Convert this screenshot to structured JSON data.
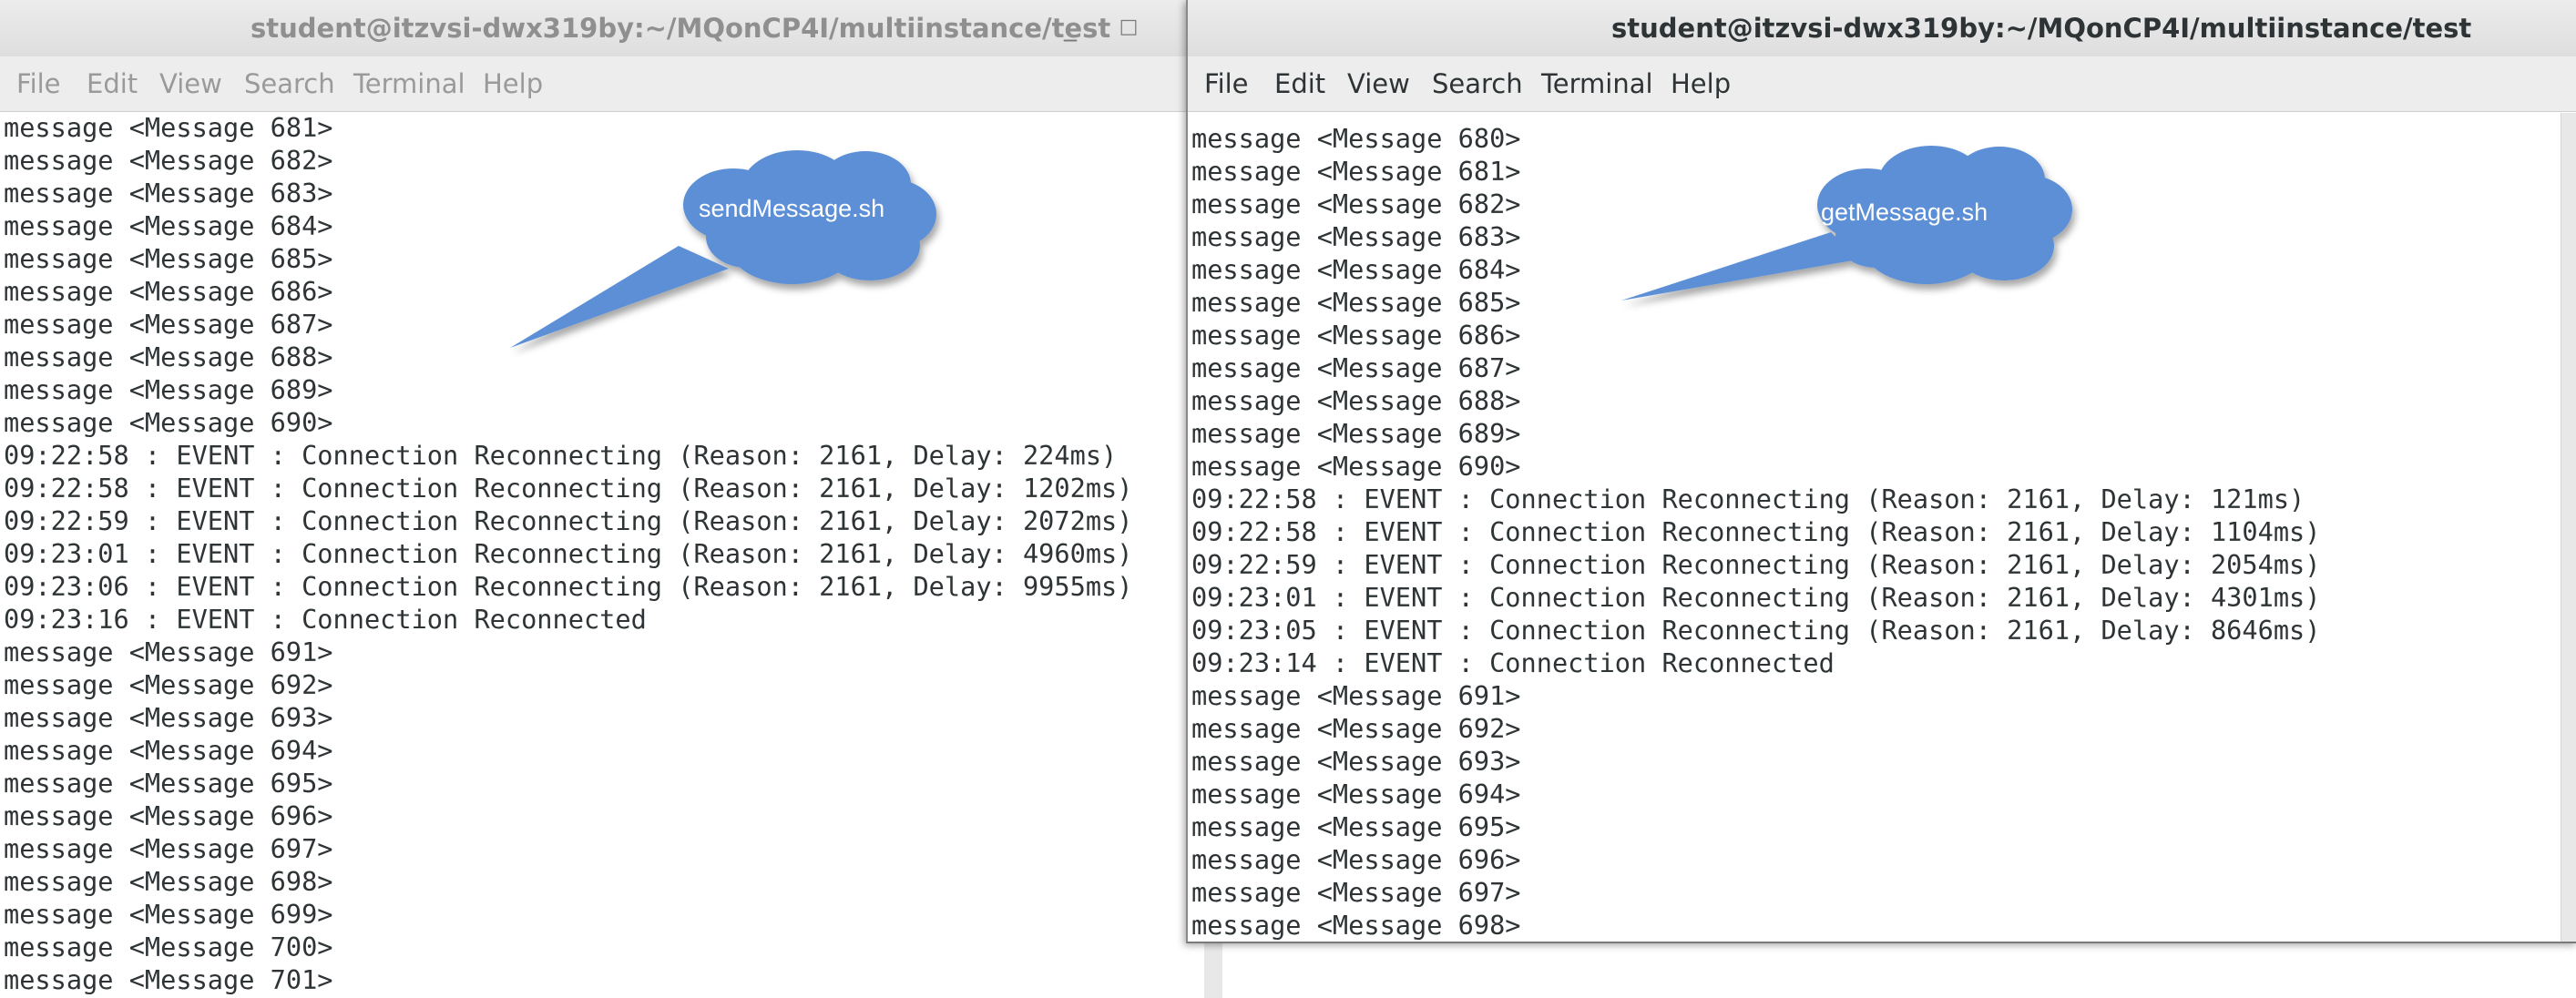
{
  "left_window": {
    "title": "student@itzvsi-dwx319by:~/MQonCP4I/multiinstance/test",
    "menu": [
      "File",
      "Edit",
      "View",
      "Search",
      "Terminal",
      "Help"
    ],
    "lines": [
      "message <Message 681>",
      "message <Message 682>",
      "message <Message 683>",
      "message <Message 684>",
      "message <Message 685>",
      "message <Message 686>",
      "message <Message 687>",
      "message <Message 688>",
      "message <Message 689>",
      "message <Message 690>",
      "09:22:58 : EVENT : Connection Reconnecting (Reason: 2161, Delay: 224ms)",
      "09:22:58 : EVENT : Connection Reconnecting (Reason: 2161, Delay: 1202ms)",
      "09:22:59 : EVENT : Connection Reconnecting (Reason: 2161, Delay: 2072ms)",
      "09:23:01 : EVENT : Connection Reconnecting (Reason: 2161, Delay: 4960ms)",
      "09:23:06 : EVENT : Connection Reconnecting (Reason: 2161, Delay: 9955ms)",
      "09:23:16 : EVENT : Connection Reconnected",
      "message <Message 691>",
      "message <Message 692>",
      "message <Message 693>",
      "message <Message 694>",
      "message <Message 695>",
      "message <Message 696>",
      "message <Message 697>",
      "message <Message 698>",
      "message <Message 699>",
      "message <Message 700>",
      "message <Message 701>"
    ]
  },
  "right_window": {
    "title": "student@itzvsi-dwx319by:~/MQonCP4I/multiinstance/test",
    "menu": [
      "File",
      "Edit",
      "View",
      "Search",
      "Terminal",
      "Help"
    ],
    "lines": [
      "message <Message 680>",
      "message <Message 681>",
      "message <Message 682>",
      "message <Message 683>",
      "message <Message 684>",
      "message <Message 685>",
      "message <Message 686>",
      "message <Message 687>",
      "message <Message 688>",
      "message <Message 689>",
      "message <Message 690>",
      "09:22:58 : EVENT : Connection Reconnecting (Reason: 2161, Delay: 121ms)",
      "09:22:58 : EVENT : Connection Reconnecting (Reason: 2161, Delay: 1104ms)",
      "09:22:59 : EVENT : Connection Reconnecting (Reason: 2161, Delay: 2054ms)",
      "09:23:01 : EVENT : Connection Reconnecting (Reason: 2161, Delay: 4301ms)",
      "09:23:05 : EVENT : Connection Reconnecting (Reason: 2161, Delay: 8646ms)",
      "09:23:14 : EVENT : Connection Reconnected",
      "message <Message 691>",
      "message <Message 692>",
      "message <Message 693>",
      "message <Message 694>",
      "message <Message 695>",
      "message <Message 696>",
      "message <Message 697>",
      "message <Message 698>"
    ]
  },
  "callouts": {
    "left": "sendMessage.sh",
    "right": "getMessage.sh",
    "fill_color": "#5b8fd6"
  },
  "icons": [
    "minimize-icon",
    "maximize-icon",
    "close-icon"
  ]
}
